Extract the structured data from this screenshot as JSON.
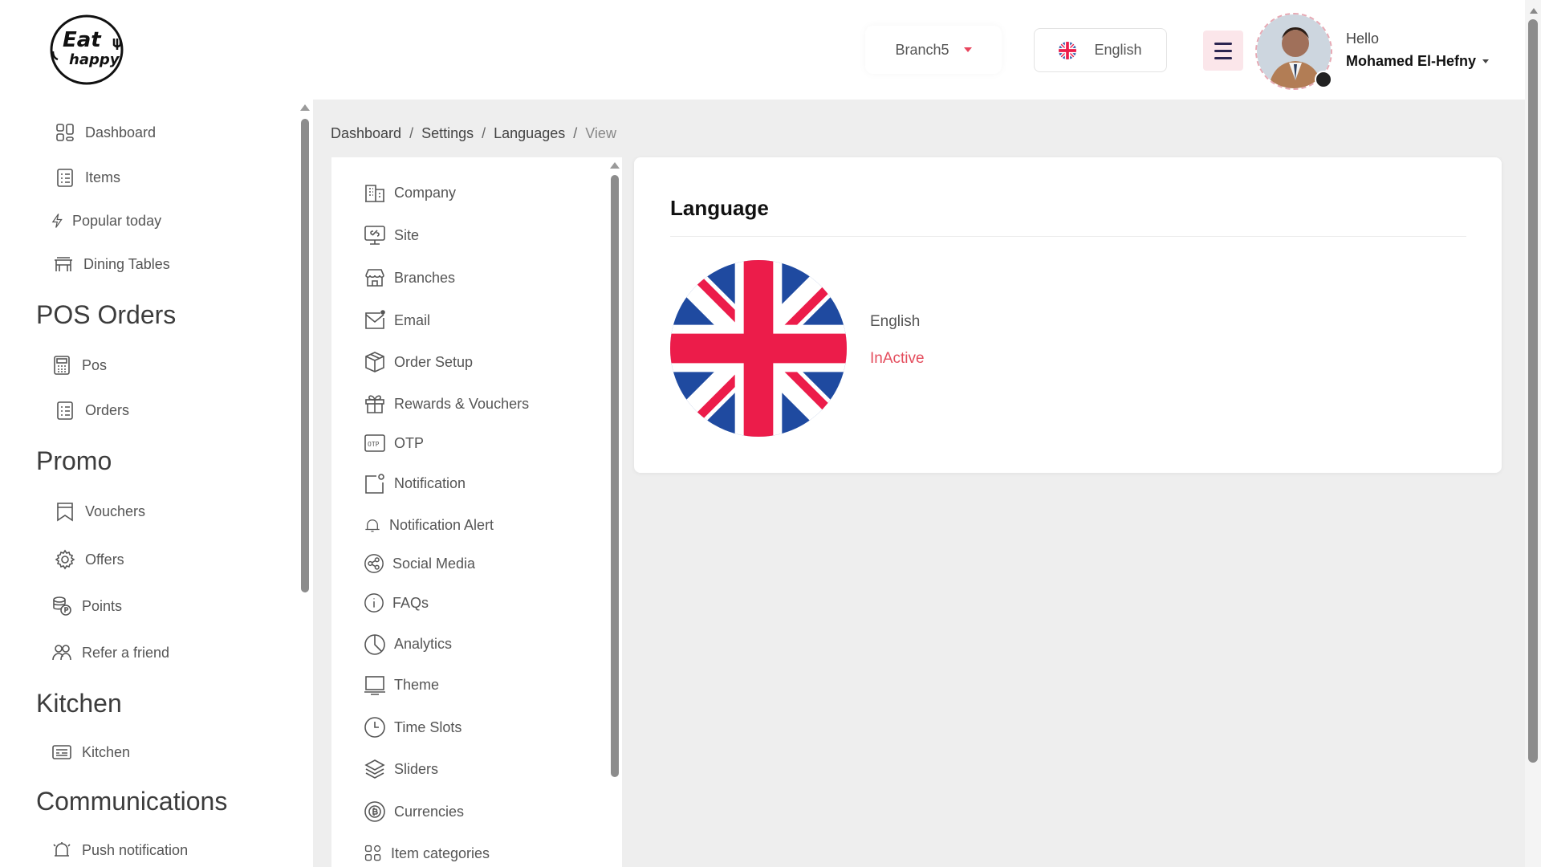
{
  "header": {
    "logo_text_top": "Eat",
    "logo_text_bottom": "happy",
    "branch": "Branch5",
    "language": "English",
    "greeting": "Hello",
    "user_name": "Mohamed El-Hefny"
  },
  "sidebar": {
    "items_top": [
      {
        "label": "Dashboard",
        "icon": "dashboard-icon"
      },
      {
        "label": "Items",
        "icon": "items-icon"
      },
      {
        "label": "Popular today",
        "icon": "bolt-icon"
      },
      {
        "label": "Dining Tables",
        "icon": "table-icon"
      }
    ],
    "sections": [
      {
        "title": "POS Orders",
        "items": [
          {
            "label": "Pos",
            "icon": "calculator-icon"
          },
          {
            "label": "Orders",
            "icon": "orders-icon"
          }
        ]
      },
      {
        "title": "Promo",
        "items": [
          {
            "label": "Vouchers",
            "icon": "voucher-icon"
          },
          {
            "label": "Offers",
            "icon": "offers-icon"
          },
          {
            "label": "Points",
            "icon": "coins-icon"
          },
          {
            "label": "Refer a friend",
            "icon": "users-icon"
          }
        ]
      },
      {
        "title": "Kitchen",
        "items": [
          {
            "label": "Kitchen",
            "icon": "kitchen-icon"
          }
        ]
      },
      {
        "title": "Communications",
        "items": [
          {
            "label": "Push notification",
            "icon": "bell-ring-icon"
          }
        ]
      }
    ]
  },
  "breadcrumb": [
    "Dashboard",
    "Settings",
    "Languages",
    "View"
  ],
  "settings_menu": [
    {
      "label": "Company",
      "icon": "building-icon"
    },
    {
      "label": "Site",
      "icon": "site-icon"
    },
    {
      "label": "Branches",
      "icon": "store-icon"
    },
    {
      "label": "Email",
      "icon": "mail-icon"
    },
    {
      "label": "Order Setup",
      "icon": "box-icon"
    },
    {
      "label": "Rewards & Vouchers",
      "icon": "gift-icon"
    },
    {
      "label": "OTP",
      "icon": "otp-icon"
    },
    {
      "label": "Notification",
      "icon": "notification-icon"
    },
    {
      "label": "Notification Alert",
      "icon": "bell-icon"
    },
    {
      "label": "Social Media",
      "icon": "share-icon"
    },
    {
      "label": "FAQs",
      "icon": "info-icon"
    },
    {
      "label": "Analytics",
      "icon": "pie-chart-icon"
    },
    {
      "label": "Theme",
      "icon": "monitor-icon"
    },
    {
      "label": "Time Slots",
      "icon": "clock-icon"
    },
    {
      "label": "Sliders",
      "icon": "layers-icon"
    },
    {
      "label": "Currencies",
      "icon": "currency-icon"
    },
    {
      "label": "Item categories",
      "icon": "grid-icon"
    }
  ],
  "card": {
    "title": "Language",
    "language_name": "English",
    "status": "InActive"
  },
  "colors": {
    "accent": "#e44d5d",
    "menu_bg": "#fbe6ea",
    "flag_blue": "#1f4aa0",
    "flag_red": "#ec1c4a"
  }
}
